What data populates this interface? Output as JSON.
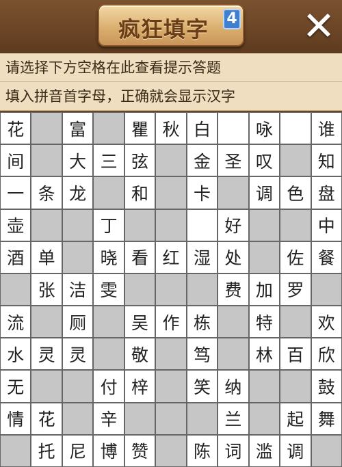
{
  "header": {
    "title": "疯狂填字",
    "badge": "4",
    "close_icon": "close-icon"
  },
  "hints": {
    "line1": "请选择下方空格在此查看提示答题",
    "line2": "填入拼音首字母，正确就会显示汉字"
  },
  "colors": {
    "background": "#6b4424",
    "hint_bar": "#efdfc0",
    "cell_white": "#ffffff",
    "cell_gray": "#c6c6c6"
  },
  "grid": [
    [
      "花",
      "#",
      "富",
      "#",
      "瞿",
      "秋",
      "白",
      "",
      "咏",
      "",
      "谁"
    ],
    [
      "间",
      "#",
      "大",
      "三",
      "弦",
      "#",
      "金",
      "圣",
      "叹",
      "#",
      "知"
    ],
    [
      "一",
      "条",
      "龙",
      "#",
      "和",
      "#",
      "卡",
      "#",
      "调",
      "色",
      "盘"
    ],
    [
      "壶",
      "#",
      "#",
      "丁",
      "#",
      "#",
      "",
      "好",
      "#",
      "#",
      "中"
    ],
    [
      "酒",
      "单",
      "#",
      "晓",
      "看",
      "红",
      "湿",
      "处",
      "#",
      "佐",
      "餐"
    ],
    [
      "#",
      "张",
      "洁",
      "雯",
      "#",
      "#",
      "#",
      "费",
      "加",
      "罗",
      "#"
    ],
    [
      "流",
      "#",
      "厕",
      "#",
      "吴",
      "作",
      "栋",
      "#",
      "特",
      "#",
      "欢"
    ],
    [
      "水",
      "灵",
      "灵",
      "#",
      "敬",
      "#",
      "笃",
      "#",
      "林",
      "百",
      "欣"
    ],
    [
      "无",
      "#",
      "#",
      "付",
      "梓",
      "#",
      "笑",
      "纳",
      "#",
      "#",
      "鼓"
    ],
    [
      "情",
      "花",
      "#",
      "辛",
      "#",
      "#",
      "#",
      "兰",
      "#",
      "起",
      "舞"
    ],
    [
      "#",
      "托",
      "尼",
      "博",
      "赞",
      "#",
      "陈",
      "词",
      "滥",
      "调",
      "#"
    ]
  ]
}
